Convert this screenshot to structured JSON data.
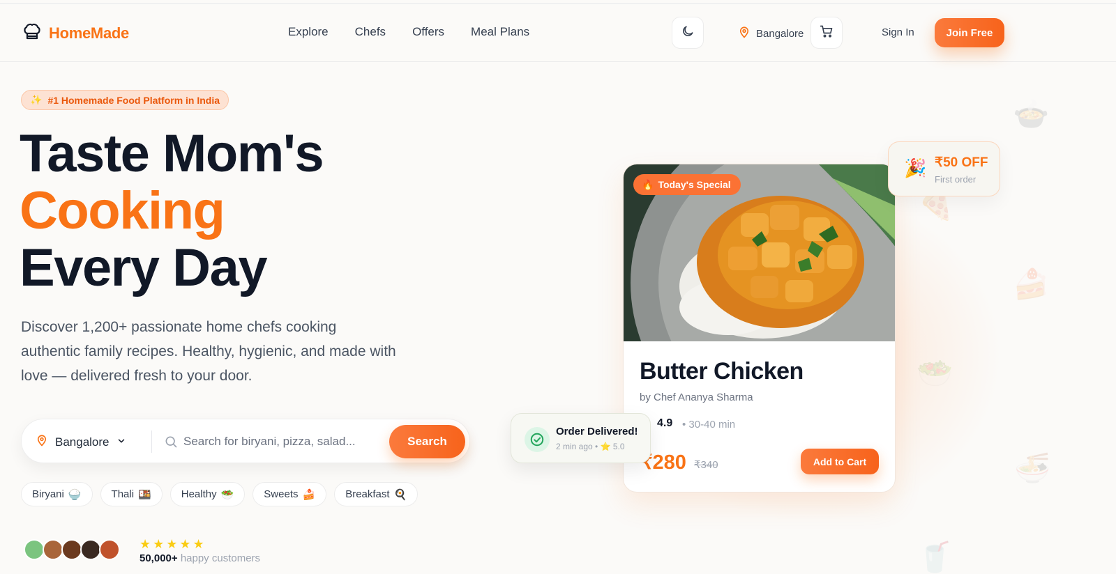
{
  "brand": {
    "name": "HomeMade"
  },
  "nav": {
    "items": [
      "Explore",
      "Chefs",
      "Offers",
      "Meal Plans"
    ]
  },
  "header": {
    "location": "Bangalore",
    "sign_in": "Sign In",
    "join": "Join Free"
  },
  "hero": {
    "badge_emoji": "✨",
    "badge": "#1 Homemade Food Platform in India",
    "title_line1": "Taste Mom's",
    "title_accent": "Cooking",
    "title_line3": "Every Day",
    "description": "Discover 1,200+ passionate home chefs cooking authentic family recipes. Healthy, hygienic, and made with love — delivered fresh to your door."
  },
  "search": {
    "location": "Bangalore",
    "placeholder": "Search for biryani, pizza, salad...",
    "button": "Search"
  },
  "tags": [
    {
      "label": "Biryani",
      "emoji": "🍚"
    },
    {
      "label": "Thali",
      "emoji": "🍱"
    },
    {
      "label": "Healthy",
      "emoji": "🥗"
    },
    {
      "label": "Sweets",
      "emoji": "🍰"
    },
    {
      "label": "Breakfast",
      "emoji": "🍳"
    }
  ],
  "social_proof": {
    "stars": "★★★★★",
    "count": "50,000+",
    "label": "happy customers"
  },
  "card": {
    "badge_emoji": "🔥",
    "badge": "Today's Special",
    "dish": "Butter Chicken",
    "chef": "by Chef Ananya Sharma",
    "rating": "4.9",
    "time": "• 30-40 min",
    "price": "₹280",
    "old_price": "₹340",
    "add_to_cart": "Add to Cart"
  },
  "delivered": {
    "title": "Order Delivered!",
    "time": "2 min ago •",
    "rating_icon": "⭐",
    "rating": "5.0"
  },
  "offer": {
    "emoji": "🎉",
    "title": "₹50 OFF",
    "subtitle": "First order"
  },
  "colors": {
    "accent": "#f97316",
    "text": "#111827",
    "muted": "#6b7280",
    "background": "#fbfaf8"
  }
}
